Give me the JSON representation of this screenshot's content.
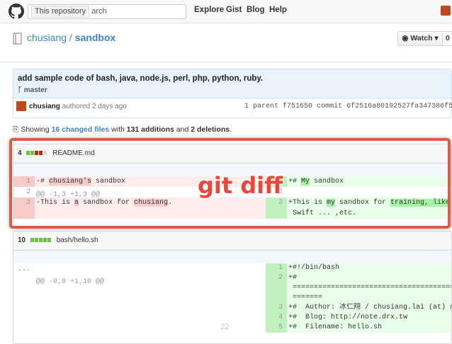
{
  "header": {
    "search_scope": "This repository",
    "search_placeholder": "Search",
    "search_visible": "arch",
    "nav": [
      "Explore",
      "Gist",
      "Blog",
      "Help"
    ]
  },
  "repo": {
    "owner": "chusiang",
    "separator": " / ",
    "name": "sandbox",
    "watch_label": "Watch",
    "watch_count": "0"
  },
  "commit": {
    "message": "add sample code of bash, java, node.js, perl, php, python, ruby.",
    "branch": "master",
    "author": "chusiang",
    "authored": "authored 2 days ago",
    "parent_label": "1 parent",
    "parent_sha": "f751650",
    "commit_label": "commit",
    "commit_sha": "6f2516a80192527fa347386f5"
  },
  "toc": {
    "prefix": "Showing ",
    "changed": "16 changed files",
    "with": " with ",
    "additions": "131 additions",
    "and": " and ",
    "deletions": "2 deletions",
    "suffix": "."
  },
  "files": [
    {
      "count": "4",
      "name": "README.md",
      "hunk": "@@ -1,3 +1,3 @@",
      "left": [
        {
          "ln": "1",
          "parts": [
            {
              "t": "-# ",
              "h": false
            },
            {
              "t": "chusiang's",
              "h": true
            },
            {
              "t": " sandbox",
              "h": false
            }
          ]
        },
        {
          "ln": "2",
          "parts": [
            {
              "t": "",
              "h": false
            }
          ]
        },
        {
          "ln": "3",
          "parts": [
            {
              "t": "-This is ",
              "h": false
            },
            {
              "t": "a",
              "h": true
            },
            {
              "t": " sandbox for ",
              "h": false
            },
            {
              "t": "chusiang",
              "h": true
            },
            {
              "t": ".",
              "h": false
            }
          ]
        }
      ],
      "right": [
        {
          "ln": "1",
          "parts": [
            {
              "t": "+# ",
              "h": false
            },
            {
              "t": "My",
              "h": true
            },
            {
              "t": " sandbox",
              "h": false
            }
          ]
        },
        {
          "ln": "2",
          "parts": [
            {
              "t": "",
              "h": false
            }
          ]
        },
        {
          "ln": "3",
          "parts": [
            {
              "t": "+This is ",
              "h": false
            },
            {
              "t": "my",
              "h": true
            },
            {
              "t": " sandbox for ",
              "h": false
            },
            {
              "t": "training, like",
              "h": true
            }
          ]
        },
        {
          "ln": "",
          "parts": [
            {
              "t": " Swift ... ,etc.",
              "h": false
            }
          ]
        }
      ]
    },
    {
      "count": "10",
      "name": "bash/hello.sh",
      "hunk": "@@ -0,0 +1,10 @@",
      "right": [
        {
          "ln": "1",
          "text": "+#!/bin/bash"
        },
        {
          "ln": "2",
          "text": "+#"
        },
        {
          "ln": "",
          "text": " =============================================="
        },
        {
          "ln": "",
          "text": " ======="
        },
        {
          "ln": "3",
          "text": "+#  Author: 冰仁翔 / chusiang.lai (at) g"
        },
        {
          "ln": "4",
          "text": "+#  Blog: http://note.drx.tw"
        },
        {
          "ln": "5",
          "text": "+#  Filename: hello.sh"
        }
      ]
    }
  ],
  "annotation": "git diff",
  "page_number": "22"
}
